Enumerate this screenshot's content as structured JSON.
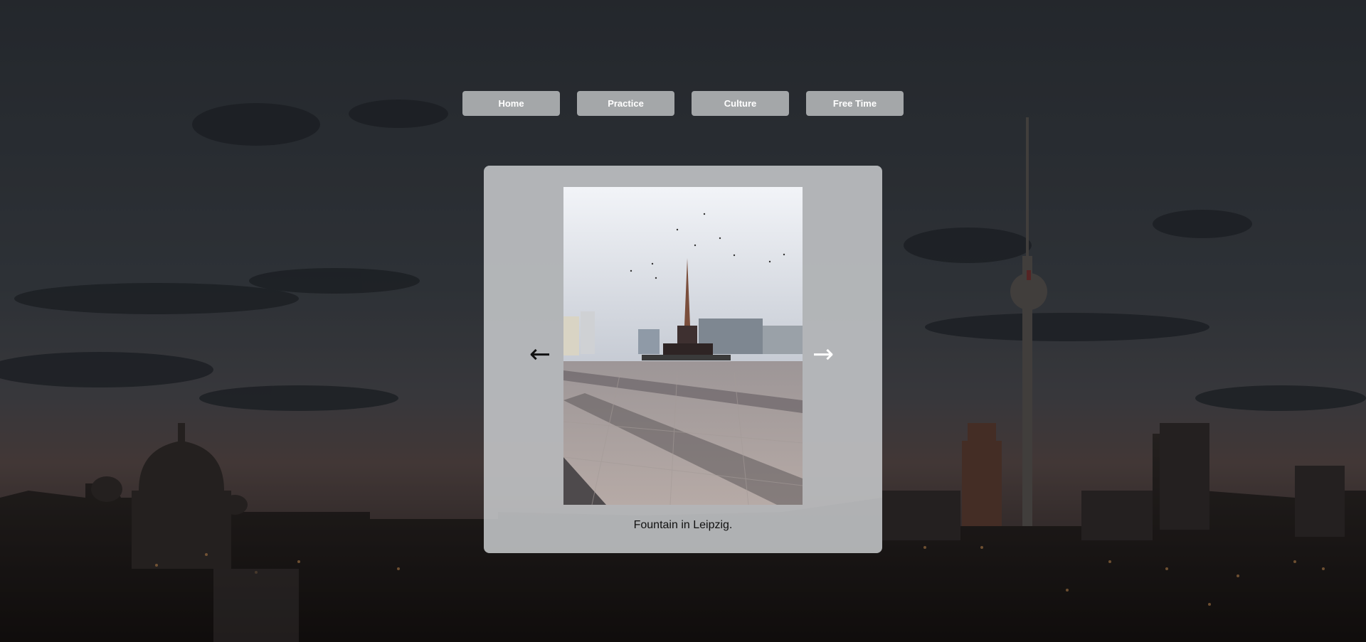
{
  "nav": {
    "items": [
      {
        "label": "Home"
      },
      {
        "label": "Practice"
      },
      {
        "label": "Culture"
      },
      {
        "label": "Free Time"
      }
    ]
  },
  "slideshow": {
    "prev_icon": "arrow-left-icon",
    "prev_glyph": "←",
    "next_icon": "arrow-right-icon",
    "next_glyph": "→",
    "caption": "Fountain in Leipzig."
  },
  "colors": {
    "nav_button_bg": "#c8cacc",
    "card_bg": "#c8cbcd",
    "night_sky": "#2a2f36"
  }
}
